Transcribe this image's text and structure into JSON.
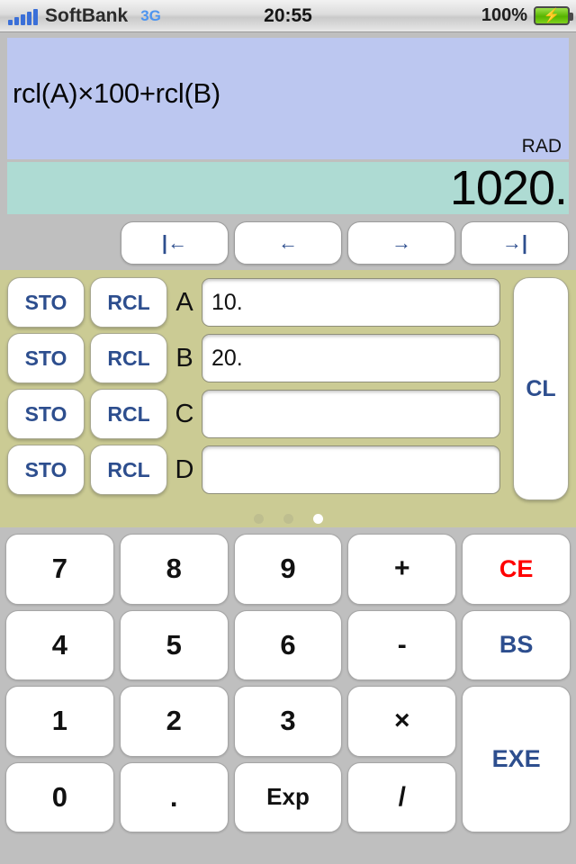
{
  "statusbar": {
    "carrier": "SoftBank",
    "network": "3G",
    "time": "20:55",
    "battery_percent": "100%",
    "battery_icon": "battery-charging-icon",
    "signal_icon": "signal-bars-icon",
    "bolt_glyph": "⚡"
  },
  "display": {
    "expression": "rcl(A)×100+rcl(B)",
    "angle_mode": "RAD",
    "result": "1020.",
    "expression_bg": "#bcc7f0",
    "result_bg": "#aedbd3"
  },
  "cursor_nav": {
    "buttons": [
      {
        "label": "|←",
        "name": "cursor-home-button"
      },
      {
        "label": "←",
        "name": "cursor-left-button"
      },
      {
        "label": "→",
        "name": "cursor-right-button"
      },
      {
        "label": "→|",
        "name": "cursor-end-button"
      }
    ]
  },
  "memory": {
    "panel_bg": "#cbcb94",
    "sto_label": "STO",
    "rcl_label": "RCL",
    "clear_label": "CL",
    "registers": [
      {
        "name": "A",
        "value": "10."
      },
      {
        "name": "B",
        "value": "20."
      },
      {
        "name": "C",
        "value": ""
      },
      {
        "name": "D",
        "value": ""
      }
    ],
    "page_dots": {
      "count": 3,
      "active_index": 2
    }
  },
  "keypad": {
    "accent_blue": "#2d4e8e",
    "accent_red": "#ff0000",
    "keys": [
      {
        "label": "7",
        "name": "key-7",
        "style": "num"
      },
      {
        "label": "8",
        "name": "key-8",
        "style": "num"
      },
      {
        "label": "9",
        "name": "key-9",
        "style": "num"
      },
      {
        "label": "+",
        "name": "key-plus",
        "style": "op"
      },
      {
        "label": "CE",
        "name": "key-ce",
        "style": "ce"
      },
      {
        "label": "4",
        "name": "key-4",
        "style": "num"
      },
      {
        "label": "5",
        "name": "key-5",
        "style": "num"
      },
      {
        "label": "6",
        "name": "key-6",
        "style": "num"
      },
      {
        "label": "-",
        "name": "key-minus",
        "style": "op"
      },
      {
        "label": "BS",
        "name": "key-bs",
        "style": "bs"
      },
      {
        "label": "1",
        "name": "key-1",
        "style": "num"
      },
      {
        "label": "2",
        "name": "key-2",
        "style": "num"
      },
      {
        "label": "3",
        "name": "key-3",
        "style": "num"
      },
      {
        "label": "×",
        "name": "key-multiply",
        "style": "op"
      },
      {
        "label": "EXE",
        "name": "key-exe",
        "style": "exe"
      },
      {
        "label": "0",
        "name": "key-0",
        "style": "num"
      },
      {
        "label": ".",
        "name": "key-decimal",
        "style": "num"
      },
      {
        "label": "Exp",
        "name": "key-exp",
        "style": "small"
      },
      {
        "label": "/",
        "name": "key-divide",
        "style": "op"
      }
    ]
  }
}
